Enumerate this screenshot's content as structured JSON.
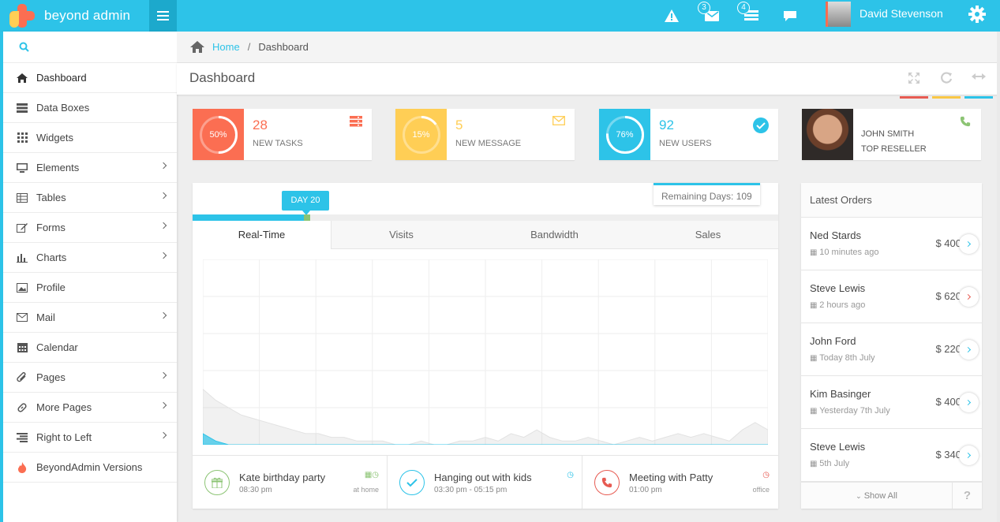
{
  "app": {
    "logo_text": "beyond admin",
    "colors": {
      "accent": "#2dc3e8",
      "red": "#fb6e52",
      "yellow": "#ffce55",
      "green": "#8cc474",
      "orange": "#e75b52"
    }
  },
  "topbar": {
    "icons": [
      "warning-icon",
      "envelope-icon",
      "tasks-icon",
      "chat-icon",
      "gear-icon"
    ],
    "mail_badge": "3",
    "tasks_badge": "4",
    "user_name": "David Stevenson"
  },
  "sidebar": {
    "search_icon": "search-icon",
    "items": [
      {
        "label": "Dashboard",
        "icon": "home-icon",
        "has_submenu": false,
        "active": true
      },
      {
        "label": "Data Boxes",
        "icon": "th-icon",
        "has_submenu": false
      },
      {
        "label": "Widgets",
        "icon": "grid-icon",
        "has_submenu": false
      },
      {
        "label": "Elements",
        "icon": "desktop-icon",
        "has_submenu": true
      },
      {
        "label": "Tables",
        "icon": "table-icon",
        "has_submenu": true
      },
      {
        "label": "Forms",
        "icon": "pencil-icon",
        "has_submenu": true
      },
      {
        "label": "Charts",
        "icon": "bar-chart-icon",
        "has_submenu": true
      },
      {
        "label": "Profile",
        "icon": "picture-icon",
        "has_submenu": false
      },
      {
        "label": "Mail",
        "icon": "envelope-icon",
        "has_submenu": true
      },
      {
        "label": "Calendar",
        "icon": "calendar-icon",
        "has_submenu": false
      },
      {
        "label": "Pages",
        "icon": "paperclip-icon",
        "has_submenu": true
      },
      {
        "label": "More Pages",
        "icon": "link-icon",
        "has_submenu": true
      },
      {
        "label": "Right to Left",
        "icon": "align-right-icon",
        "has_submenu": true
      },
      {
        "label": "BeyondAdmin Versions",
        "icon": "fire-icon",
        "has_submenu": false
      }
    ]
  },
  "breadcrumb": {
    "home": "Home",
    "sep": "/",
    "current": "Dashboard"
  },
  "header": {
    "title": "Dashboard",
    "buttons": [
      "expand-icon",
      "refresh-icon",
      "collapse-icon"
    ]
  },
  "stats": [
    {
      "percent": "50%",
      "value": "28",
      "label": "NEW TASKS",
      "color": "#fb6e52",
      "icon": "tasks-icon"
    },
    {
      "percent": "15%",
      "value": "5",
      "label": "NEW MESSAGE",
      "color": "#ffce55",
      "icon": "envelope-icon"
    },
    {
      "percent": "76%",
      "value": "92",
      "label": "NEW USERS",
      "color": "#2dc3e8",
      "icon": "check-circle-icon"
    }
  ],
  "profile_card": {
    "name": "JOHN SMITH",
    "role": "TOP RESELLER",
    "icon": "phone-icon"
  },
  "chart_panel": {
    "day_tag": "DAY 20",
    "remaining": "Remaining Days: 109",
    "tabs": [
      "Real-Time",
      "Visits",
      "Bandwidth",
      "Sales"
    ],
    "progress": 0.19
  },
  "chart_data": {
    "type": "area",
    "title": "",
    "xlabel": "",
    "ylabel": "",
    "series": [
      {
        "values": [
          15,
          12,
          10,
          8,
          7,
          6,
          5,
          4,
          3,
          3,
          2,
          2,
          1,
          1,
          1,
          0,
          0,
          1,
          0,
          0,
          1,
          1,
          2,
          1,
          3,
          2,
          4,
          2,
          1,
          1,
          2,
          1,
          0,
          1,
          2,
          1,
          2,
          3,
          2,
          3,
          2,
          1,
          4,
          6,
          4
        ]
      },
      {
        "values": [
          3,
          1,
          0,
          0,
          0,
          0,
          0,
          0,
          0,
          0,
          0,
          0,
          0,
          0,
          0,
          0,
          0,
          0,
          0,
          0,
          0,
          0,
          0,
          0,
          0,
          0,
          0,
          0,
          0,
          0,
          0,
          0,
          0,
          0,
          0,
          0,
          0,
          0,
          0,
          0,
          0,
          0,
          0,
          0,
          0
        ]
      }
    ],
    "ylim": [
      0,
      50
    ],
    "grid": true
  },
  "events": [
    {
      "title": "Kate birthday party",
      "time": "08:30 pm",
      "meta": "at home",
      "icon": "gift-icon",
      "color": "#8cc474"
    },
    {
      "title": "Hanging out with kids",
      "time": "03:30 pm - 05:15 pm",
      "meta": "",
      "icon": "check-icon",
      "color": "#2dc3e8"
    },
    {
      "title": "Meeting with Patty",
      "time": "01:00 pm",
      "meta": "office",
      "icon": "phone-icon",
      "color": "#e75b52"
    }
  ],
  "orders": {
    "title": "Latest Orders",
    "items": [
      {
        "name": "Ned Stards",
        "time": "10 minutes ago",
        "price": "$ 400",
        "color": "#2dc3e8"
      },
      {
        "name": "Steve Lewis",
        "time": "2 hours ago",
        "price": "$ 620",
        "color": "#e75b52"
      },
      {
        "name": "John Ford",
        "time": "Today 8th July",
        "price": "$ 220",
        "color": "#2dc3e8"
      },
      {
        "name": "Kim Basinger",
        "time": "Yesterday 7th July",
        "price": "$ 400",
        "color": "#2dc3e8"
      },
      {
        "name": "Steve Lewis",
        "time": "5th July",
        "price": "$ 340",
        "color": "#2dc3e8"
      }
    ],
    "show_all": "Show All",
    "help": "?"
  }
}
